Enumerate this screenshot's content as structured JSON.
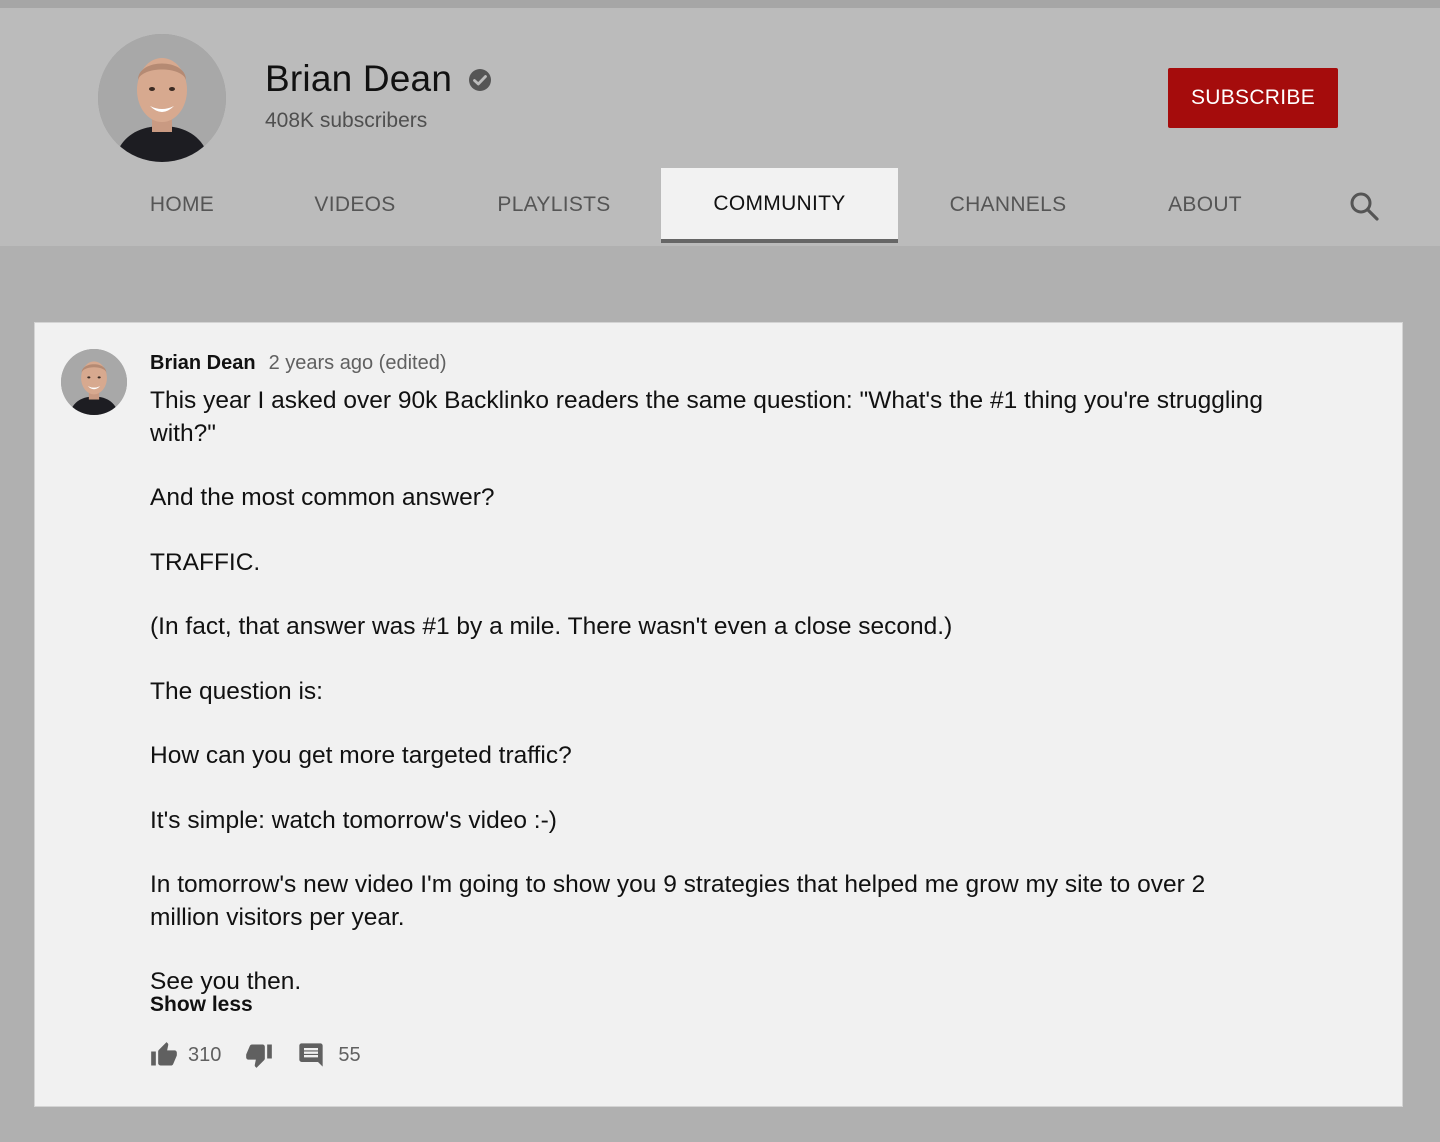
{
  "channel": {
    "name": "Brian Dean",
    "subscribers": "408K subscribers",
    "verified": true,
    "subscribe_label": "SUBSCRIBE"
  },
  "tabs": [
    {
      "label": "HOME"
    },
    {
      "label": "VIDEOS"
    },
    {
      "label": "PLAYLISTS"
    },
    {
      "label": "COMMUNITY",
      "active": true
    },
    {
      "label": "CHANNELS"
    },
    {
      "label": "ABOUT"
    }
  ],
  "post": {
    "author": "Brian Dean",
    "time": "2 years ago (edited)",
    "paragraphs": [
      "This year I asked over 90k Backlinko readers the same question:  \"What's the #1 thing you're struggling with?\"",
      "And the most common answer?",
      "TRAFFIC.",
      "(In fact, that answer was #1 by a mile. There wasn't even a close second.)",
      "The question is:",
      "How can you get more targeted traffic?",
      "It's simple: watch tomorrow's video :-)",
      "In tomorrow's new video I'm going to show you 9 strategies that helped me grow my site to over 2 million visitors per year.",
      "See you then."
    ],
    "show_less": "Show less",
    "likes": "310",
    "comments": "55"
  },
  "icons": {
    "verified": "verified-check-icon",
    "search": "search-icon",
    "like": "thumbs-up-icon",
    "dislike": "thumbs-down-icon",
    "comment": "comment-icon"
  },
  "colors": {
    "subscribe": "#a50c0c",
    "header_bg": "#bbbbbb",
    "page_bg": "#b0b0b0",
    "card_bg": "#f1f1f1"
  }
}
